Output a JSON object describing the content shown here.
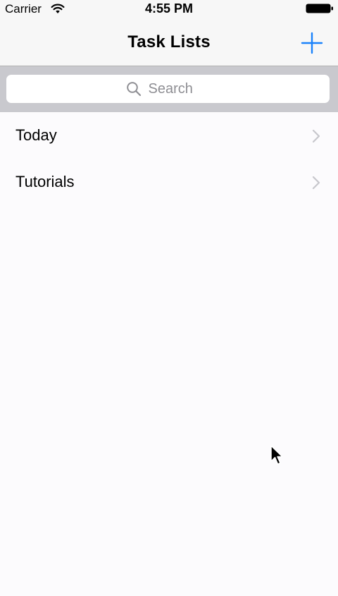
{
  "status_bar": {
    "carrier": "Carrier",
    "time": "4:55 PM",
    "icons": [
      "wifi-icon",
      "battery-icon"
    ]
  },
  "nav_bar": {
    "title": "Task Lists",
    "add_icon": "plus-icon",
    "accent_color": "#1a82fb"
  },
  "search": {
    "placeholder": "Search",
    "value": ""
  },
  "lists": [
    {
      "label": "Today"
    },
    {
      "label": "Tutorials"
    }
  ],
  "colors": {
    "background": "#fcfbfd",
    "bar_background": "#f7f7f7",
    "search_bar_background": "#c9c9ce",
    "chevron": "#c7c7cc"
  }
}
